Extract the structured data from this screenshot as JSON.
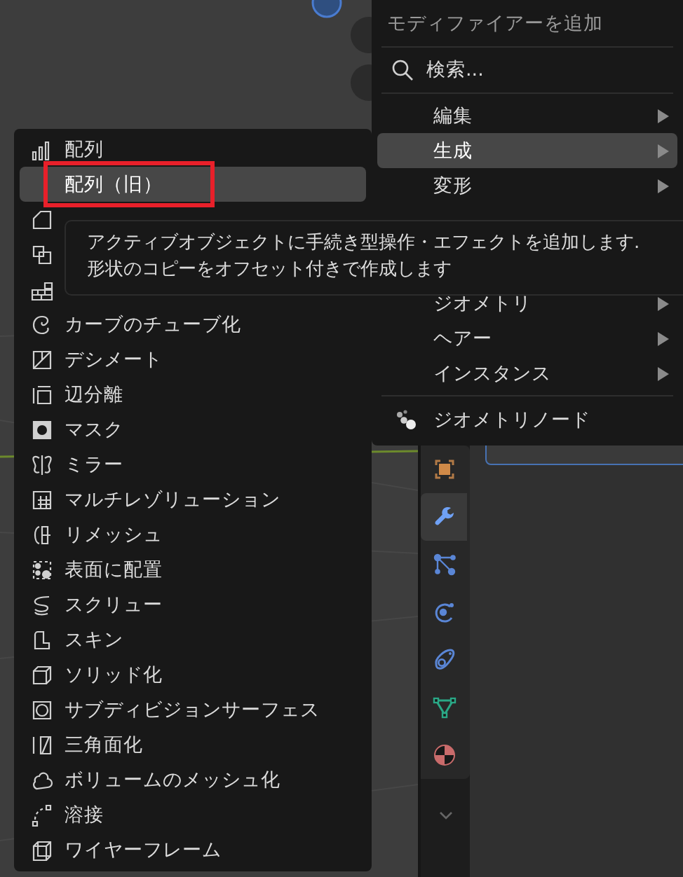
{
  "left_menu": {
    "items": [
      {
        "label": "配列",
        "selected": false,
        "framed": false
      },
      {
        "label": "配列（旧）",
        "selected": true,
        "framed": true
      },
      {
        "kind": "covered"
      },
      {
        "kind": "covered"
      },
      {
        "kind": "covered"
      },
      {
        "label": "カーブのチューブ化",
        "selected": false,
        "framed": false
      },
      {
        "label": "デシメート",
        "selected": false,
        "framed": false
      },
      {
        "label": "辺分離",
        "selected": false,
        "framed": false
      },
      {
        "label": "マスク",
        "selected": false,
        "framed": false
      },
      {
        "label": "ミラー",
        "selected": false,
        "framed": false
      },
      {
        "label": "マルチレゾリューション",
        "selected": false,
        "framed": false
      },
      {
        "label": "リメッシュ",
        "selected": false,
        "framed": false
      },
      {
        "label": "表面に配置",
        "selected": false,
        "framed": false
      },
      {
        "label": "スクリュー",
        "selected": false,
        "framed": false
      },
      {
        "label": "スキン",
        "selected": false,
        "framed": false
      },
      {
        "label": "ソリッド化",
        "selected": false,
        "framed": false
      },
      {
        "label": "サブディビジョンサーフェス",
        "selected": false,
        "framed": false
      },
      {
        "label": "三角面化",
        "selected": false,
        "framed": false
      },
      {
        "label": "ボリュームのメッシュ化",
        "selected": false,
        "framed": false
      },
      {
        "label": "溶接",
        "selected": false,
        "framed": false
      },
      {
        "label": "ワイヤーフレーム",
        "selected": false,
        "framed": false
      }
    ]
  },
  "right_menu": {
    "title": "モディファイアーを追加",
    "search": {
      "placeholder": "検索..."
    },
    "items": [
      {
        "label": "編集",
        "selected": false,
        "submenu": true
      },
      {
        "label": "生成",
        "selected": true,
        "submenu": true
      },
      {
        "label": "変形",
        "selected": false,
        "submenu": true
      },
      {
        "kind": "covered"
      },
      {
        "kind": "covered"
      },
      {
        "kind": "gap"
      },
      {
        "label": "ジオメトリ",
        "selected": false,
        "submenu": true
      },
      {
        "label": "ヘアー",
        "selected": false,
        "submenu": true
      },
      {
        "label": "インスタンス",
        "selected": false,
        "submenu": true
      },
      {
        "kind": "separator"
      },
      {
        "label": "ジオメトリノード",
        "kind": "nodes",
        "selected": false,
        "submenu": false
      }
    ]
  },
  "tooltip": {
    "lines": [
      "アクティブオブジェクトに手続き型操作・エフェクトを追加します.",
      "形状のコピーをオフセット付きで作成します"
    ]
  },
  "properties_tabs": [
    {
      "selected": false
    },
    {
      "selected": true
    },
    {
      "selected": false
    },
    {
      "selected": false
    },
    {
      "selected": false
    },
    {
      "selected": false
    },
    {
      "selected": false
    }
  ]
}
